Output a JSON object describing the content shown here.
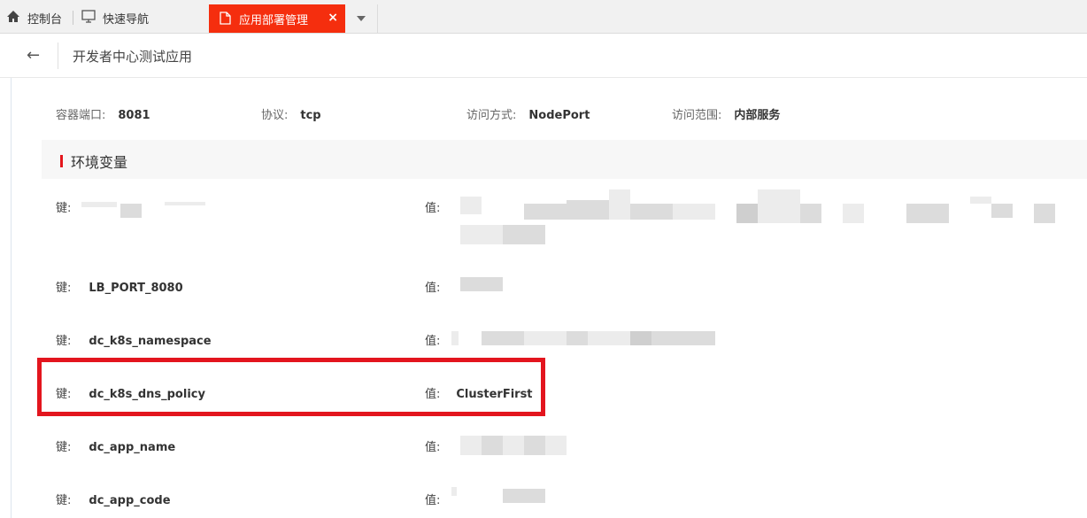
{
  "tabs": {
    "home_label": "控制台",
    "nav_label": "快速导航",
    "active_label": "应用部署管理",
    "close_glyph": "×",
    "more_glyph": "▾"
  },
  "header": {
    "back_glyph": "←",
    "title": "开发者中心测试应用"
  },
  "container": {
    "port_label": "容器端口:",
    "port_value": "8081",
    "protocol_label": "协议:",
    "protocol_value": "tcp",
    "access_label": "访问方式:",
    "access_value": "NodePort",
    "scope_label": "访问范围:",
    "scope_value": "内部服务"
  },
  "env_section": {
    "title": "环境变量",
    "key_label": "键:",
    "value_label": "值:",
    "rows": [
      {
        "key": "",
        "value": ""
      },
      {
        "key": "LB_PORT_8080",
        "value": ""
      },
      {
        "key": "dc_k8s_namespace",
        "value": ""
      },
      {
        "key": "dc_k8s_dns_policy",
        "value": "ClusterFirst"
      },
      {
        "key": "dc_app_name",
        "value": ""
      },
      {
        "key": "dc_app_code",
        "value": ""
      }
    ]
  }
}
